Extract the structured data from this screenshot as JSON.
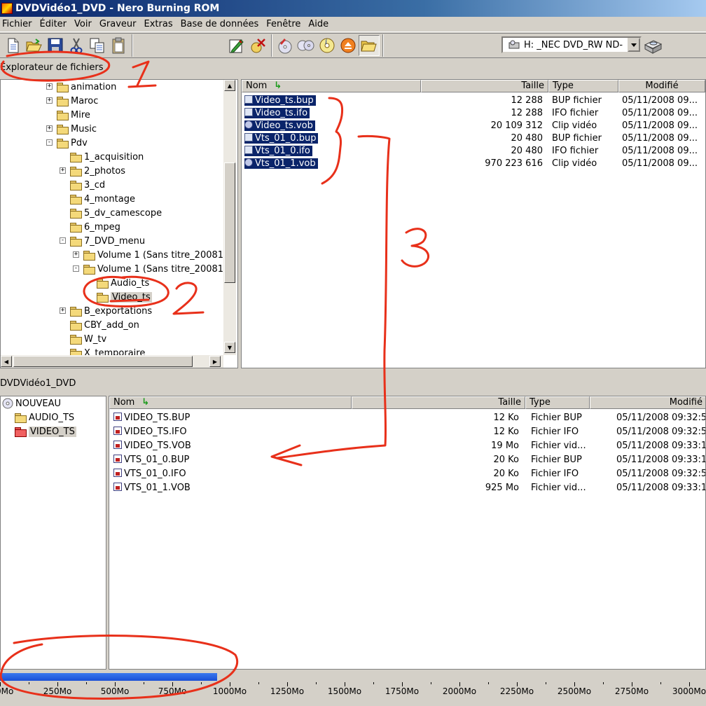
{
  "window": {
    "title": "DVDVidéo1_DVD - Nero Burning ROM"
  },
  "menu": [
    "Fichier",
    "Éditer",
    "Voir",
    "Graveur",
    "Extras",
    "Base de données",
    "Fenêtre",
    "Aide"
  ],
  "toolbar": {
    "groups": [
      [
        "new-document-icon",
        "open-folder-icon",
        "save-disk-icon",
        "cut-scissors-icon",
        "copy-icon",
        "paste-icon"
      ],
      [
        "burn-compilation-icon",
        "erase-disc-icon"
      ],
      [
        "disc-info-icon",
        "copy-disc-icon",
        "cd-info-icon",
        "eject-icon",
        "browser-folder-icon"
      ]
    ],
    "drive": "H: _NEC     DVD_RW ND-"
  },
  "explorer": {
    "label": "Explorateur de fichiers",
    "tree": [
      {
        "label": "animation",
        "level": 0,
        "expander": "+"
      },
      {
        "label": "Maroc",
        "level": 0,
        "expander": "+"
      },
      {
        "label": "Mire",
        "level": 0,
        "expander": ""
      },
      {
        "label": "Music",
        "level": 0,
        "expander": "+"
      },
      {
        "label": "Pdv",
        "level": 0,
        "expander": "-"
      },
      {
        "label": "1_acquisition",
        "level": 1,
        "expander": ""
      },
      {
        "label": "2_photos",
        "level": 1,
        "expander": "+"
      },
      {
        "label": "3_cd",
        "level": 1,
        "expander": ""
      },
      {
        "label": "4_montage",
        "level": 1,
        "expander": ""
      },
      {
        "label": "5_dv_camescope",
        "level": 1,
        "expander": ""
      },
      {
        "label": "6_mpeg",
        "level": 1,
        "expander": ""
      },
      {
        "label": "7_DVD_menu",
        "level": 1,
        "expander": "-"
      },
      {
        "label": "Volume 1 (Sans titre_200811",
        "level": 2,
        "expander": "+"
      },
      {
        "label": "Volume 1 (Sans titre_200811",
        "level": 2,
        "expander": "-"
      },
      {
        "label": "Audio_ts",
        "level": 3,
        "expander": ""
      },
      {
        "label": "Video_ts",
        "level": 3,
        "expander": "",
        "selected": true
      },
      {
        "label": "B_exportations",
        "level": 1,
        "expander": "+"
      },
      {
        "label": "CBY_add_on",
        "level": 1,
        "expander": ""
      },
      {
        "label": "W_tv",
        "level": 1,
        "expander": ""
      },
      {
        "label": "X_temporaire",
        "level": 1,
        "expander": ""
      }
    ],
    "columns": {
      "name": "Nom",
      "size": "Taille",
      "type": "Type",
      "modified": "Modifié"
    },
    "files": [
      {
        "name": "Video_ts.bup",
        "size": "12 288",
        "type": "BUP fichier",
        "modified": "05/11/2008 09...",
        "icon": "doc"
      },
      {
        "name": "Video_ts.ifo",
        "size": "12 288",
        "type": "IFO fichier",
        "modified": "05/11/2008 09...",
        "icon": "doc"
      },
      {
        "name": "Video_ts.vob",
        "size": "20 109 312",
        "type": "Clip vidéo",
        "modified": "05/11/2008 09...",
        "icon": "vid"
      },
      {
        "name": "Vts_01_0.bup",
        "size": "20 480",
        "type": "BUP fichier",
        "modified": "05/11/2008 09...",
        "icon": "doc"
      },
      {
        "name": "Vts_01_0.ifo",
        "size": "20 480",
        "type": "IFO fichier",
        "modified": "05/11/2008 09...",
        "icon": "doc"
      },
      {
        "name": "Vts_01_1.vob",
        "size": "970 223 616",
        "type": "Clip vidéo",
        "modified": "05/11/2008 09...",
        "icon": "vid"
      }
    ]
  },
  "compilation": {
    "label": "DVDVidéo1_DVD",
    "tree": [
      {
        "label": "NOUVEAU",
        "level": 0,
        "kind": "disc"
      },
      {
        "label": "AUDIO_TS",
        "level": 1,
        "kind": "folder"
      },
      {
        "label": "VIDEO_TS",
        "level": 1,
        "kind": "folder-red",
        "selected": true
      }
    ],
    "columns": {
      "name": "Nom",
      "size": "Taille",
      "type": "Type",
      "modified": "Modifié"
    },
    "files": [
      {
        "name": "VIDEO_TS.BUP",
        "size": "12 Ko",
        "type": "Fichier BUP",
        "modified": "05/11/2008 09:32:5"
      },
      {
        "name": "VIDEO_TS.IFO",
        "size": "12 Ko",
        "type": "Fichier IFO",
        "modified": "05/11/2008 09:32:5"
      },
      {
        "name": "VIDEO_TS.VOB",
        "size": "19 Mo",
        "type": "Fichier vid...",
        "modified": "05/11/2008 09:33:1"
      },
      {
        "name": "VTS_01_0.BUP",
        "size": "20 Ko",
        "type": "Fichier BUP",
        "modified": "05/11/2008 09:33:1"
      },
      {
        "name": "VTS_01_0.IFO",
        "size": "20 Ko",
        "type": "Fichier IFO",
        "modified": "05/11/2008 09:32:5"
      },
      {
        "name": "VTS_01_1.VOB",
        "size": "925 Mo",
        "type": "Fichier vid...",
        "modified": "05/11/2008 09:33:1"
      }
    ]
  },
  "capacity": {
    "used_mb": 945,
    "ruler": [
      "0Mo",
      "250Mo",
      "500Mo",
      "750Mo",
      "1000Mo",
      "1250Mo",
      "1500Mo",
      "1750Mo",
      "2000Mo",
      "2250Mo",
      "2500Mo",
      "2750Mo",
      "3000Mo"
    ],
    "fill_color": "#1a4fd6"
  },
  "annotations": {
    "color": "#e8301a",
    "marks": [
      "1",
      "2",
      "3"
    ]
  }
}
